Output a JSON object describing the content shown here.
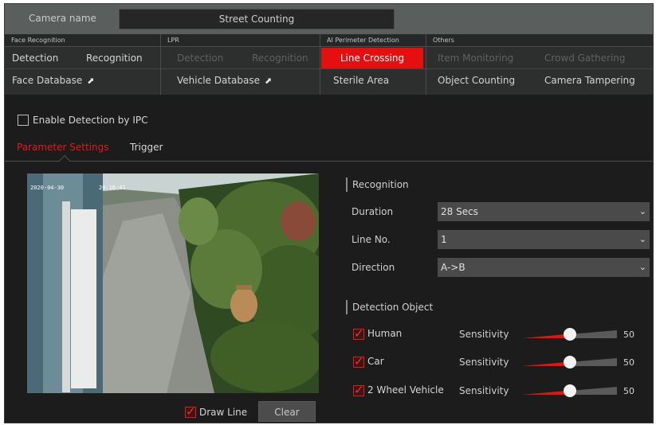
{
  "camera": {
    "label": "Camera name",
    "value": "Street Counting"
  },
  "groups": {
    "face": {
      "title": "Face Recognition",
      "tabs": [
        "Detection",
        "Recognition",
        "Face Database"
      ]
    },
    "lpr": {
      "title": "LPR",
      "tabs": [
        "Detection",
        "Recognition",
        "Vehicle Database"
      ]
    },
    "perimeter": {
      "title": "AI Perimeter Detection",
      "tabs": [
        "Line Crossing",
        "Sterile Area"
      ]
    },
    "others": {
      "title": "Others",
      "tabs": [
        "Item Monitoring",
        "Crowd Gathering",
        "Object Counting",
        "Camera Tampering"
      ]
    }
  },
  "ext_icon": "external-link-arrow",
  "enable_ipc": {
    "label": "Enable Detection by IPC",
    "checked": false
  },
  "subtabs": [
    "Parameter Settings",
    "Trigger"
  ],
  "preview": {
    "overlay": [
      "2020-04-30",
      "20:16:41"
    ]
  },
  "draw_line": {
    "label": "Draw Line",
    "checked": true
  },
  "clear_label": "Clear",
  "recognition": {
    "title": "Recognition",
    "duration": {
      "label": "Duration",
      "value": "28 Secs"
    },
    "line_no": {
      "label": "Line No.",
      "value": "1"
    },
    "direction": {
      "label": "Direction",
      "value": "A->B"
    }
  },
  "detection_object": {
    "title": "Detection Object",
    "items": [
      {
        "label": "Human",
        "checked": true,
        "sensitivity_label": "Sensitivity",
        "value": "50",
        "fraction": 0.5
      },
      {
        "label": "Car",
        "checked": true,
        "sensitivity_label": "Sensitivity",
        "value": "50",
        "fraction": 0.5
      },
      {
        "label": "2 Wheel Vehicle",
        "checked": true,
        "sensitivity_label": "Sensitivity",
        "value": "50",
        "fraction": 0.5
      }
    ]
  },
  "colors": {
    "accent": "#e60f0f",
    "panel": "#1c1c1c",
    "bar": "#5a5e5c"
  }
}
